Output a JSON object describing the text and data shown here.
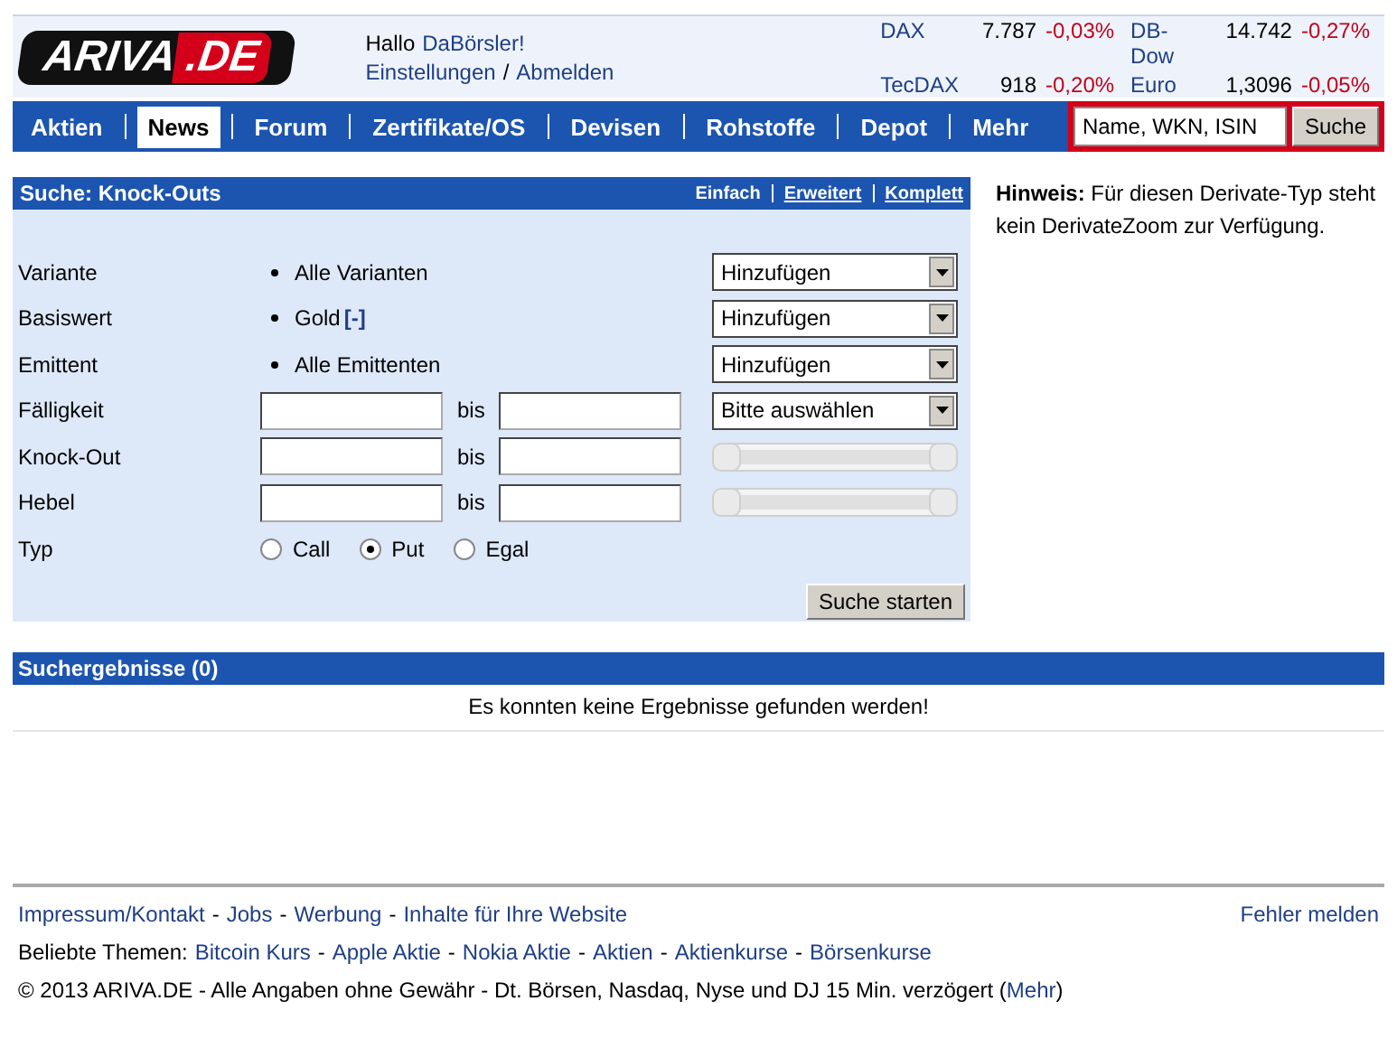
{
  "header": {
    "logo": {
      "main": "ARIVA",
      "suffix": ".DE"
    },
    "greeting": {
      "text": "Hallo",
      "user": "DaBörsler!"
    },
    "account_links": [
      {
        "kind": "link",
        "text": "Einstellungen"
      },
      {
        "kind": "text",
        "text": "/"
      },
      {
        "kind": "link",
        "text": "Abmelden"
      }
    ],
    "indices": [
      {
        "name": "DAX",
        "value": "7.787",
        "change": "-0,03%"
      },
      {
        "name": "DB-Dow",
        "value": "14.742",
        "change": "-0,27%"
      },
      {
        "name": "TecDAX",
        "value": "918",
        "change": "-0,20%"
      },
      {
        "name": "Euro",
        "value": "1,3096",
        "change": "-0,05%"
      }
    ]
  },
  "nav": {
    "items": [
      {
        "label": "Aktien",
        "selected": false
      },
      {
        "label": "News",
        "selected": true
      },
      {
        "label": "Forum",
        "selected": false
      },
      {
        "label": "Zertifikate/OS",
        "selected": false
      },
      {
        "label": "Devisen",
        "selected": false
      },
      {
        "label": "Rohstoffe",
        "selected": false
      },
      {
        "label": "Depot",
        "selected": false
      },
      {
        "label": "Mehr",
        "selected": false
      }
    ],
    "search": {
      "placeholder": "Name, WKN, ISIN",
      "button": "Suche"
    }
  },
  "search_form": {
    "title": "Suche: Knock-Outs",
    "modes": [
      {
        "label": "Einfach",
        "selected": true
      },
      {
        "label": "Erweitert",
        "selected": false
      },
      {
        "label": "Komplett",
        "selected": false
      }
    ],
    "rows": [
      {
        "kind": "choice",
        "label": "Variante",
        "value": "Alle Varianten",
        "select": "Hinzufügen"
      },
      {
        "kind": "choice",
        "label": "Basiswert",
        "value": "Gold",
        "remove": "[-]",
        "select": "Hinzufügen"
      },
      {
        "kind": "choice",
        "label": "Emittent",
        "value": "Alle Emittenten",
        "select": "Hinzufügen"
      },
      {
        "kind": "range",
        "label": "Fälligkeit",
        "between": "bis",
        "select": "Bitte auswählen"
      },
      {
        "kind": "range",
        "label": "Knock-Out",
        "between": "bis",
        "slider": {
          "level": 1
        }
      },
      {
        "kind": "range",
        "label": "Hebel",
        "between": "bis",
        "slider": {
          "level": 1
        }
      },
      {
        "kind": "radio",
        "label": "Typ",
        "options": [
          {
            "label": "Call",
            "selected": false
          },
          {
            "label": "Put",
            "selected": true
          },
          {
            "label": "Egal",
            "selected": false
          }
        ]
      }
    ],
    "submit": "Suche starten"
  },
  "hint": "**Hinweis:** Für diesen Derivate-Typ steht kein DerivateZoom zur Verfügung.",
  "results": {
    "title": "Suchergebnisse (0)",
    "message": "Es konnten keine Ergebnisse gefunden werden!"
  },
  "footer": {
    "links": [
      {
        "kind": "link",
        "text": "Impressum/Kontakt"
      },
      {
        "kind": "text",
        "text": "-"
      },
      {
        "kind": "link",
        "text": "Jobs"
      },
      {
        "kind": "text",
        "text": "-"
      },
      {
        "kind": "link",
        "text": "Werbung"
      },
      {
        "kind": "text",
        "text": "-"
      },
      {
        "kind": "link",
        "text": "Inhalte für Ihre Website"
      }
    ],
    "report": "Fehler melden",
    "topics": [
      {
        "kind": "text",
        "text": "Beliebte Themen:"
      },
      {
        "kind": "link",
        "text": "Bitcoin Kurs"
      },
      {
        "kind": "text",
        "text": "-"
      },
      {
        "kind": "link",
        "text": "Apple Aktie"
      },
      {
        "kind": "text",
        "text": "-"
      },
      {
        "kind": "link",
        "text": "Nokia Aktie"
      },
      {
        "kind": "text",
        "text": "-"
      },
      {
        "kind": "link",
        "text": "Aktien"
      },
      {
        "kind": "text",
        "text": "-"
      },
      {
        "kind": "link",
        "text": "Aktienkurse"
      },
      {
        "kind": "text",
        "text": "-"
      },
      {
        "kind": "link",
        "text": "Börsenkurse"
      }
    ],
    "copyright": {
      "before": "© 2013 ARIVA.DE - Alle Angaben ohne Gewähr - Dt. Börsen, Nasdaq, Nyse und DJ 15 Min. verzögert (",
      "link": "Mehr",
      "after": ")"
    }
  }
}
